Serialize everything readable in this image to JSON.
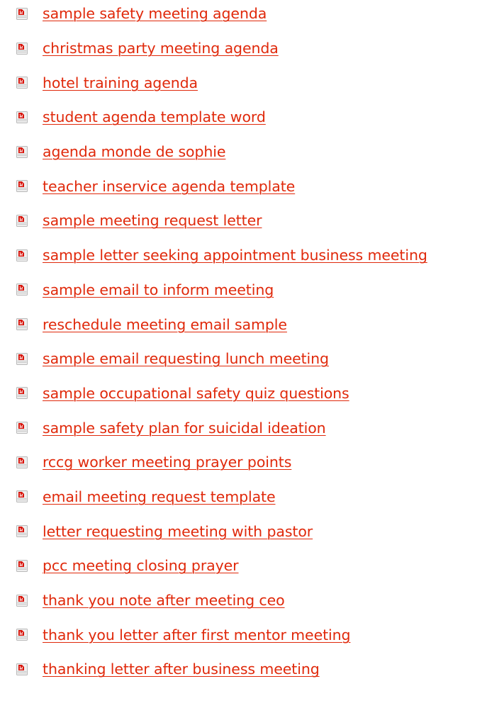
{
  "icon": "pdf-document-icon",
  "colors": {
    "link": "#e0290b",
    "icon_red": "#d8140a",
    "icon_page": "#f2f2f2"
  },
  "links": [
    {
      "label": "sample safety meeting agenda"
    },
    {
      "label": "christmas party meeting agenda"
    },
    {
      "label": "hotel training agenda"
    },
    {
      "label": "student agenda template word"
    },
    {
      "label": "agenda monde de sophie"
    },
    {
      "label": "teacher inservice agenda template"
    },
    {
      "label": "sample meeting request letter"
    },
    {
      "label": "sample letter seeking appointment business meeting"
    },
    {
      "label": "sample email to inform meeting"
    },
    {
      "label": "reschedule meeting email sample"
    },
    {
      "label": "sample email requesting lunch meeting"
    },
    {
      "label": "sample occupational safety quiz questions"
    },
    {
      "label": "sample safety plan for suicidal ideation"
    },
    {
      "label": "rccg worker meeting prayer points"
    },
    {
      "label": "email meeting request template"
    },
    {
      "label": "letter requesting meeting with pastor"
    },
    {
      "label": "pcc meeting closing prayer"
    },
    {
      "label": "thank you note after meeting ceo"
    },
    {
      "label": "thank you letter after first mentor meeting"
    },
    {
      "label": "thanking letter after business meeting"
    }
  ]
}
